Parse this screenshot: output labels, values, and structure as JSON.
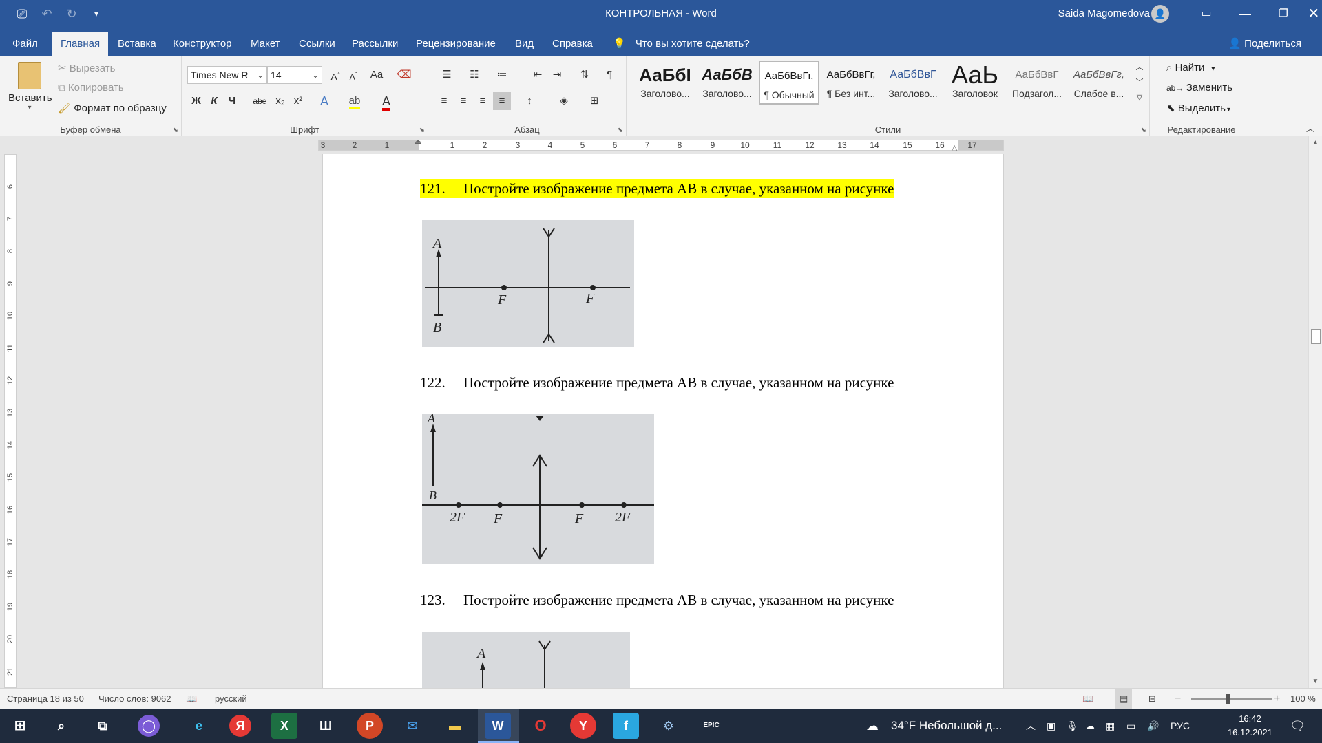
{
  "window": {
    "title": "КОНТРОЛЬНАЯ  -  Word",
    "user": "Saida Magomedova",
    "colors": {
      "brand": "#2b579a",
      "highlight": "#ffff00"
    }
  },
  "ribbon_tabs": [
    {
      "label": "Файл"
    },
    {
      "label": "Главная"
    },
    {
      "label": "Вставка"
    },
    {
      "label": "Конструктор"
    },
    {
      "label": "Макет"
    },
    {
      "label": "Ссылки"
    },
    {
      "label": "Рассылки"
    },
    {
      "label": "Рецензирование"
    },
    {
      "label": "Вид"
    },
    {
      "label": "Справка"
    }
  ],
  "tell_me": "Что вы хотите сделать?",
  "share": "Поделиться",
  "clipboard": {
    "paste": "Вставить",
    "cut": "Вырезать",
    "copy": "Копировать",
    "format_painter": "Формат по образцу",
    "label": "Буфер обмена"
  },
  "font": {
    "name": "Times New R",
    "size": "14",
    "label": "Шрифт",
    "bold": "Ж",
    "italic": "К",
    "underline": "Ч",
    "strike": "abc",
    "sub": "x₂",
    "sup": "x²"
  },
  "paragraph": {
    "label": "Абзац"
  },
  "styles": {
    "label": "Стили",
    "items": [
      {
        "preview": "АаБбI",
        "name": "Заголово..."
      },
      {
        "preview": "АаБбВ",
        "name": "Заголово..."
      },
      {
        "preview": "АаБбВвГг,",
        "name": "¶ Обычный"
      },
      {
        "preview": "АаБбВвГг,",
        "name": "¶ Без инт..."
      },
      {
        "preview": "АаБбВвГ",
        "name": "Заголово..."
      },
      {
        "preview": "АаЬ",
        "name": "Заголовок"
      },
      {
        "preview": "АаБбВвГ",
        "name": "Подзагол..."
      },
      {
        "preview": "АаБбВвГг,",
        "name": "Слабое в..."
      }
    ]
  },
  "editing": {
    "find": "Найти",
    "replace": "Заменить",
    "select": "Выделить",
    "label": "Редактирование"
  },
  "ruler": {
    "h_numbers": [
      "3",
      "2",
      "1",
      "1",
      "2",
      "3",
      "4",
      "5",
      "6",
      "7",
      "8",
      "9",
      "10",
      "11",
      "12",
      "13",
      "14",
      "15",
      "16",
      "17"
    ],
    "v_numbers": [
      "6",
      "7",
      "8",
      "9",
      "10",
      "11",
      "12",
      "13",
      "14",
      "15",
      "16",
      "17",
      "18",
      "19",
      "20",
      "21"
    ]
  },
  "document": {
    "paragraphs": [
      {
        "num": "121.",
        "text": "Постройте изображение предмета АВ в случае, указанном на рисунке"
      },
      {
        "num": "122.",
        "text": "Постройте изображение предмета АВ в случае, указанном на рисунке"
      },
      {
        "num": "123.",
        "text": "Постройте изображение предмета АВ в случае, указанном на рисунке"
      }
    ],
    "fig1": {
      "a": "A",
      "b": "B",
      "f1": "F",
      "f2": "F"
    },
    "fig2": {
      "a": "A",
      "b": "B",
      "l1": "2F",
      "l2": "F",
      "l3": "F",
      "l4": "2F"
    },
    "fig3": {
      "a": "A"
    }
  },
  "status": {
    "page": "Страница 18 из 50",
    "words": "Число слов: 9062",
    "lang": "русский",
    "zoom": "100 %"
  },
  "taskbar": {
    "weather": "34°F  Небольшой д...",
    "lang": "РУС",
    "time": "16:42",
    "date": "16.12.2021"
  }
}
